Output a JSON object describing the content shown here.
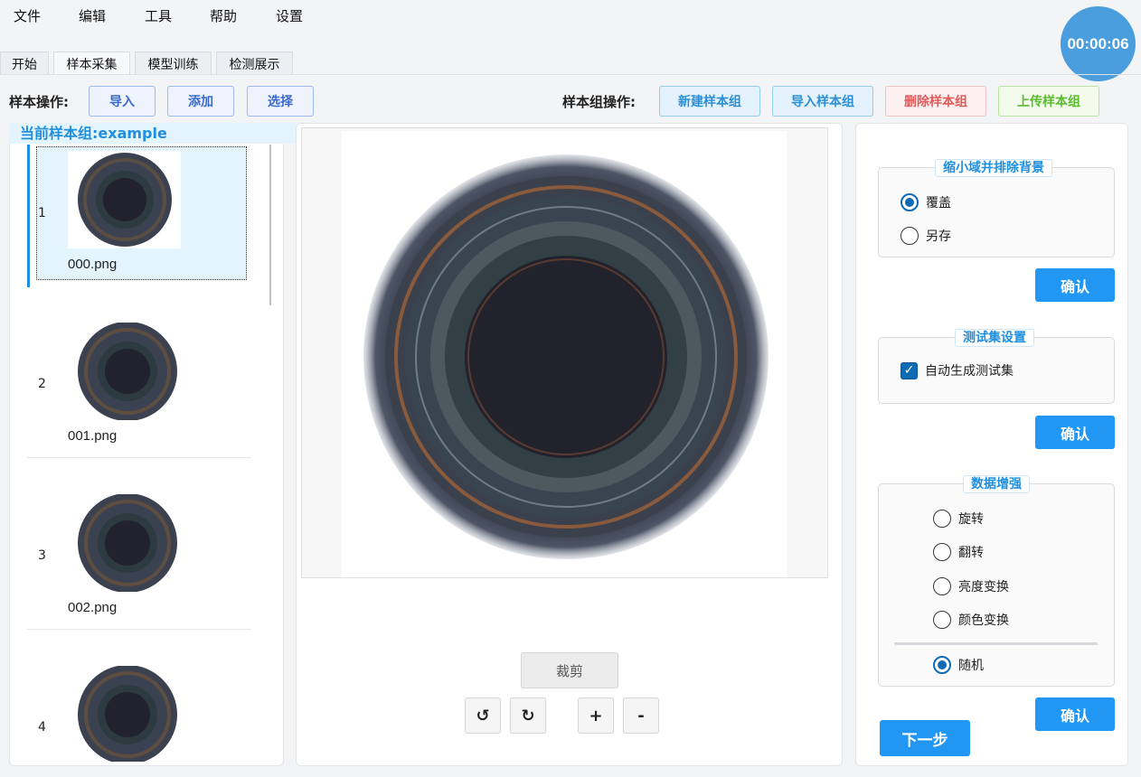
{
  "menu": [
    "文件",
    "编辑",
    "工具",
    "帮助",
    "设置"
  ],
  "timer": "00:00:06",
  "tabs": [
    "开始",
    "样本采集",
    "模型训练",
    "检测展示"
  ],
  "toolbar": {
    "sample_ops_label": "样本操作:",
    "import": "导入",
    "add": "添加",
    "select": "选择",
    "group_ops_label": "样本组操作:",
    "new_group": "新建样本组",
    "import_group": "导入样本组",
    "delete_group": "删除样本组",
    "upload_group": "上传样本组"
  },
  "current_group": "当前样本组:example",
  "samples": [
    {
      "num": "1",
      "name": "000.png"
    },
    {
      "num": "2",
      "name": "001.png"
    },
    {
      "num": "3",
      "name": "002.png"
    },
    {
      "num": "4",
      "name": ""
    }
  ],
  "image_controls": {
    "crop": "裁剪",
    "rotate_left": "↺",
    "rotate_right": "↻",
    "zoom_in": "+",
    "zoom_out": "-"
  },
  "shrink": {
    "title": "缩小域并排除背景",
    "options": [
      "覆盖",
      "另存"
    ],
    "selected": 0
  },
  "testset": {
    "title": "测试集设置",
    "auto_label": "自动生成测试集",
    "checked": true
  },
  "augment": {
    "title": "数据增强",
    "options": [
      "旋转",
      "翻转",
      "亮度变换",
      "颜色变换"
    ],
    "random_label": "随机",
    "random_selected": true
  },
  "confirm": "确认",
  "next": "下一步",
  "colors": {
    "accent": "#2196f3",
    "timer": "#4a9edd",
    "highlight": "#1f8fe0"
  }
}
